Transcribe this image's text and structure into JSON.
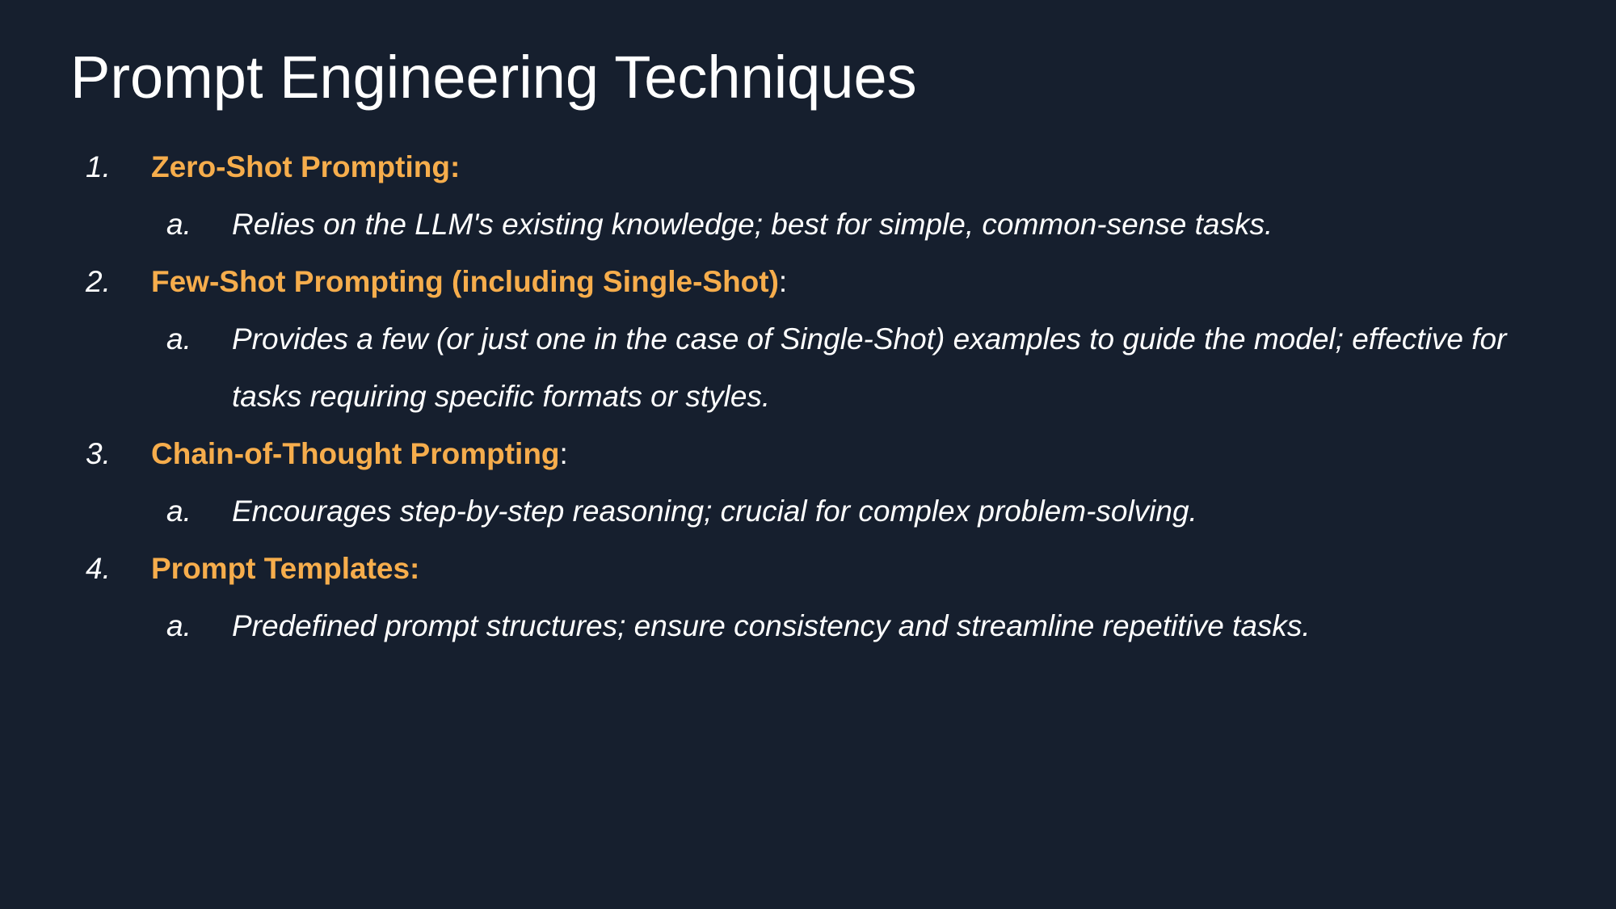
{
  "slide": {
    "title": "Prompt Engineering Techniques"
  },
  "colors": {
    "background": "#161f2e",
    "heading_accent": "#f6ad4c",
    "text": "#ffffff"
  },
  "items": [
    {
      "number": "1.",
      "heading": "Zero-Shot Prompting:",
      "trailing": "",
      "sub": {
        "letter": "a.",
        "lines": [
          "Relies on the LLM's existing knowledge; best for simple, common-sense tasks."
        ]
      }
    },
    {
      "number": "2.",
      "heading": "Few-Shot Prompting (including Single-Shot)",
      "trailing": ":",
      "sub": {
        "letter": "a.",
        "lines": [
          "Provides a few (or just one in the case of Single-Shot) examples to guide the model; effective for",
          "tasks requiring specific formats or styles."
        ]
      }
    },
    {
      "number": "3.",
      "heading": "Chain-of-Thought Prompting",
      "trailing": ":",
      "sub": {
        "letter": "a.",
        "lines": [
          "Encourages step-by-step reasoning; crucial for complex problem-solving."
        ]
      }
    },
    {
      "number": "4.",
      "heading": "Prompt Templates:",
      "trailing": "",
      "sub": {
        "letter": "a.",
        "lines": [
          "Predefined prompt structures; ensure consistency and streamline repetitive tasks."
        ]
      }
    }
  ]
}
